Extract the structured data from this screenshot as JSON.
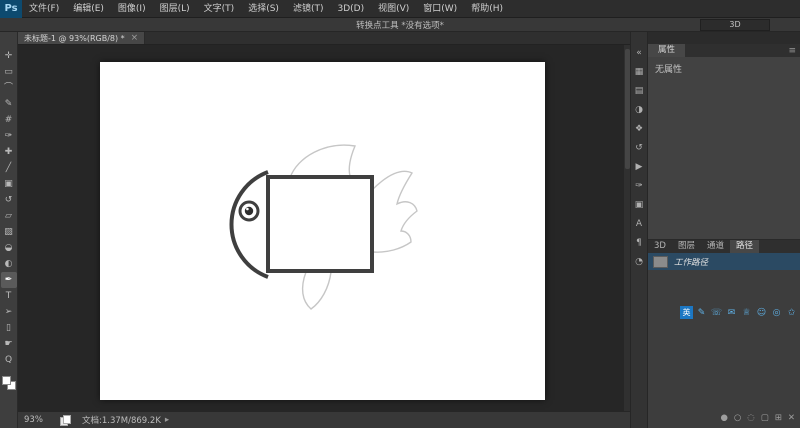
{
  "menu": {
    "logo": "Ps",
    "items": [
      "文件(F)",
      "编辑(E)",
      "图像(I)",
      "图层(L)",
      "文字(T)",
      "选择(S)",
      "滤镜(T)",
      "3D(D)",
      "视图(V)",
      "窗口(W)",
      "帮助(H)"
    ]
  },
  "options_bar": {
    "tool_hint": "转换点工具  *没有选项*",
    "right_button": "3D"
  },
  "document_tab": {
    "title": "未标题-1 @ 93%(RGB/8) *",
    "close_glyph": "×"
  },
  "tools": [
    {
      "name": "move-tool",
      "glyph": "✛"
    },
    {
      "name": "rectangular-marquee-tool",
      "glyph": "▭"
    },
    {
      "name": "lasso-tool",
      "glyph": "⌒"
    },
    {
      "name": "quick-selection-tool",
      "glyph": "✎"
    },
    {
      "name": "crop-tool",
      "glyph": "#"
    },
    {
      "name": "eyedropper-tool",
      "glyph": "✑"
    },
    {
      "name": "healing-brush-tool",
      "glyph": "✚"
    },
    {
      "name": "brush-tool",
      "glyph": "╱"
    },
    {
      "name": "clone-stamp-tool",
      "glyph": "▣"
    },
    {
      "name": "history-brush-tool",
      "glyph": "↺"
    },
    {
      "name": "eraser-tool",
      "glyph": "▱"
    },
    {
      "name": "gradient-tool",
      "glyph": "▨"
    },
    {
      "name": "blur-tool",
      "glyph": "◒"
    },
    {
      "name": "dodge-tool",
      "glyph": "◐"
    },
    {
      "name": "pen-tool",
      "glyph": "✒",
      "selected": true
    },
    {
      "name": "type-tool",
      "glyph": "T"
    },
    {
      "name": "path-selection-tool",
      "glyph": "➢"
    },
    {
      "name": "shape-tool",
      "glyph": "▯"
    },
    {
      "name": "hand-tool",
      "glyph": "☛"
    },
    {
      "name": "zoom-tool",
      "glyph": "Q"
    }
  ],
  "panel_strip": [
    {
      "name": "collapse-panels-icon",
      "glyph": "«"
    },
    {
      "name": "color-panel-icon",
      "glyph": "▦"
    },
    {
      "name": "swatches-panel-icon",
      "glyph": "▤"
    },
    {
      "name": "adjustments-panel-icon",
      "glyph": "◑"
    },
    {
      "name": "styles-panel-icon",
      "glyph": "❖"
    },
    {
      "name": "history-panel-icon",
      "glyph": "↺"
    },
    {
      "name": "actions-panel-icon",
      "glyph": "▶"
    },
    {
      "name": "brush-presets-panel-icon",
      "glyph": "✑"
    },
    {
      "name": "clone-source-panel-icon",
      "glyph": "▣"
    },
    {
      "name": "character-panel-icon",
      "glyph": "A"
    },
    {
      "name": "paragraph-panel-icon",
      "glyph": "¶"
    },
    {
      "name": "timeline-panel-icon",
      "glyph": "◔"
    }
  ],
  "properties_panel": {
    "tab": "属性",
    "empty_text": "无属性",
    "menu_glyph": "≡"
  },
  "paths_panel": {
    "tabs": [
      {
        "name": "tab-3d",
        "label": "3D"
      },
      {
        "name": "tab-layers",
        "label": "图层"
      },
      {
        "name": "tab-channels",
        "label": "通道"
      },
      {
        "name": "tab-paths",
        "label": "路径",
        "selected": true
      }
    ],
    "items": [
      {
        "label": "工作路径"
      }
    ]
  },
  "taskbar": {
    "icons": [
      {
        "name": "input-method-icon",
        "glyph": "英",
        "selected": true
      },
      {
        "name": "taskbar-pen-icon",
        "glyph": "✎"
      },
      {
        "name": "taskbar-phone-icon",
        "glyph": "☏"
      },
      {
        "name": "taskbar-mail-icon",
        "glyph": "✉"
      },
      {
        "name": "taskbar-store-icon",
        "glyph": "♕"
      },
      {
        "name": "taskbar-user-icon",
        "glyph": "☺"
      },
      {
        "name": "taskbar-search-icon",
        "glyph": "◎"
      },
      {
        "name": "taskbar-star-icon",
        "glyph": "✩"
      }
    ]
  },
  "panel_footer": [
    {
      "name": "fill-path-icon",
      "glyph": "●"
    },
    {
      "name": "stroke-path-icon",
      "glyph": "○"
    },
    {
      "name": "load-selection-icon",
      "glyph": "◌"
    },
    {
      "name": "vector-mask-icon",
      "glyph": "▢"
    },
    {
      "name": "new-path-icon",
      "glyph": "⊞"
    },
    {
      "name": "delete-path-icon",
      "glyph": "✕"
    }
  ],
  "status_bar": {
    "zoom": "93%",
    "doc_label": "文档:1.37M/869.2K",
    "expand_glyph": "▸"
  },
  "canvas": {
    "outline_color": "#3f3f3f",
    "sketch_color": "#c6c6c6",
    "pupil_color": "#2e2e2e"
  }
}
